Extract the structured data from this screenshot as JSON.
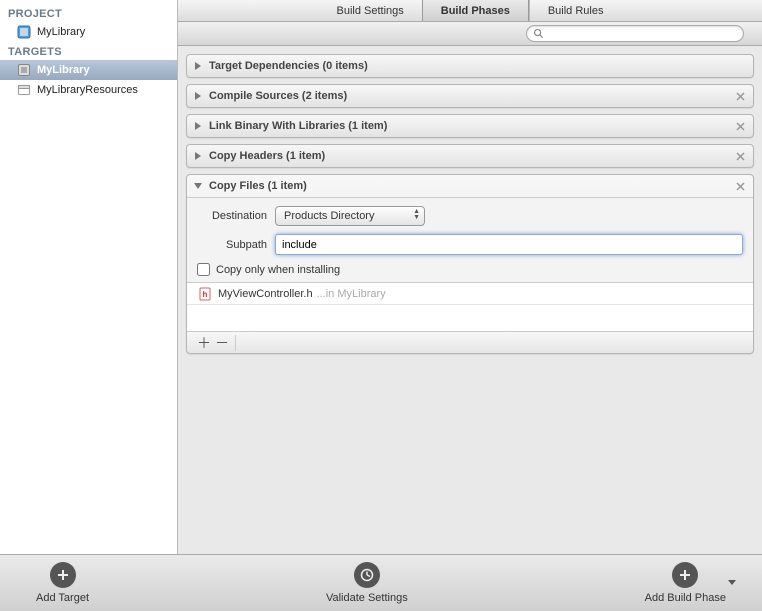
{
  "sidebar": {
    "project_header": "PROJECT",
    "project_item": "MyLibrary",
    "targets_header": "TARGETS",
    "targets": [
      {
        "label": "MyLibrary",
        "selected": true
      },
      {
        "label": "MyLibraryResources",
        "selected": false
      }
    ]
  },
  "tabs": {
    "items": [
      "Build Settings",
      "Build Phases",
      "Build Rules"
    ],
    "active_index": 1
  },
  "search": {
    "placeholder": ""
  },
  "phases": [
    {
      "title": "Target Dependencies (0 items)",
      "expanded": false,
      "closable": false
    },
    {
      "title": "Compile Sources (2 items)",
      "expanded": false,
      "closable": true
    },
    {
      "title": "Link Binary With Libraries (1 item)",
      "expanded": false,
      "closable": true
    },
    {
      "title": "Copy Headers (1 item)",
      "expanded": false,
      "closable": true
    }
  ],
  "copy_files": {
    "title": "Copy Files (1 item)",
    "destination_label": "Destination",
    "destination_value": "Products Directory",
    "subpath_label": "Subpath",
    "subpath_value": "include",
    "copy_only_label": "Copy only when installing",
    "copy_only_checked": false,
    "file": {
      "name": "MyViewController.h",
      "location": "...in MyLibrary"
    }
  },
  "footer": {
    "add_target": "Add Target",
    "validate_settings": "Validate Settings",
    "add_build_phase": "Add Build Phase"
  }
}
